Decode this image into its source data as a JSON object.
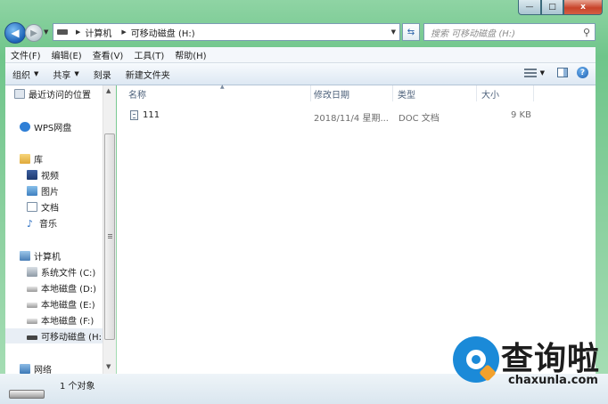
{
  "window": {
    "controls": {
      "minimize": "—",
      "maximize": "□",
      "close": "x"
    }
  },
  "address": {
    "segments": [
      "计算机",
      "可移动磁盘 (H:)"
    ],
    "refresh_icon": "refresh-arrows-icon"
  },
  "search": {
    "placeholder": "搜索 可移动磁盘 (H:)"
  },
  "menubar": {
    "items": [
      "文件(F)",
      "编辑(E)",
      "查看(V)",
      "工具(T)",
      "帮助(H)"
    ]
  },
  "commandbar": {
    "organize": "组织",
    "share": "共享",
    "burn": "刻录",
    "new_folder": "新建文件夹"
  },
  "navpane": {
    "recent": "最近访问的位置",
    "wps": "WPS网盘",
    "library": "库",
    "video": "视频",
    "pictures": "图片",
    "documents": "文档",
    "music": "音乐",
    "computer": "计算机",
    "drive_c": "系统文件 (C:)",
    "drive_d": "本地磁盘 (D:)",
    "drive_e": "本地磁盘 (E:)",
    "drive_f": "本地磁盘 (F:)",
    "drive_h": "可移动磁盘 (H:)",
    "network": "网络"
  },
  "columns": {
    "name": "名称",
    "modified": "修改日期",
    "type": "类型",
    "size": "大小"
  },
  "files": [
    {
      "name": "111",
      "modified": "2018/11/4 星期...",
      "type": "DOC 文档",
      "size": "9 KB"
    }
  ],
  "status": {
    "count_text": "1 个对象"
  },
  "watermark": {
    "cn": "查询啦",
    "en": "chaxunla.com"
  }
}
